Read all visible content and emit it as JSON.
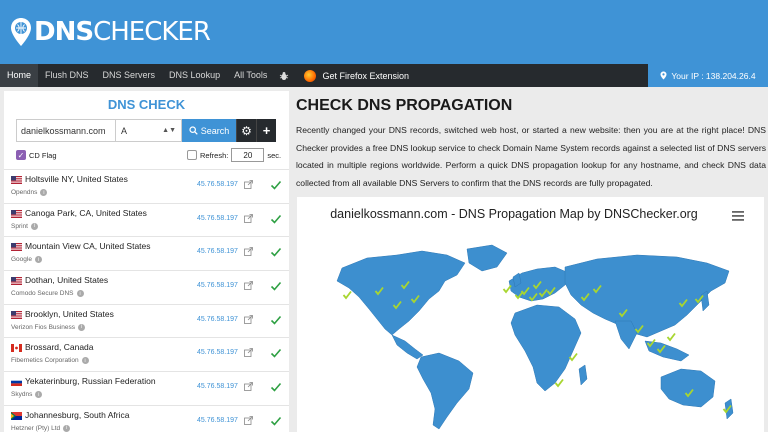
{
  "header": {
    "logo_dns": "DNS",
    "logo_checker": "CHECKER"
  },
  "nav": {
    "items": [
      "Home",
      "Flush DNS",
      "DNS Servers",
      "DNS Lookup",
      "All Tools"
    ],
    "firefox": "Get Firefox Extension",
    "ip": "Your IP : 138.204.26.4"
  },
  "dns_check": {
    "title": "DNS CHECK",
    "domain_value": "danielkossmann.com",
    "record_type": "A",
    "search_label": "Search",
    "cd_flag_label": "CD Flag",
    "refresh_label": "Refresh:",
    "refresh_value": "20",
    "refresh_unit": "sec."
  },
  "servers": [
    {
      "location": "Holtsville NY, United States",
      "provider": "Opendns",
      "ip": "45.76.58.197",
      "flag": "us"
    },
    {
      "location": "Canoga Park, CA, United States",
      "provider": "Sprint",
      "ip": "45.76.58.197",
      "flag": "us"
    },
    {
      "location": "Mountain View CA, United States",
      "provider": "Google",
      "ip": "45.76.58.197",
      "flag": "us"
    },
    {
      "location": "Dothan, United States",
      "provider": "Comodo Secure DNS",
      "ip": "45.76.58.197",
      "flag": "us"
    },
    {
      "location": "Brooklyn, United States",
      "provider": "Verizon Fios Business",
      "ip": "45.76.58.197",
      "flag": "us"
    },
    {
      "location": "Brossard, Canada",
      "provider": "Fibernetics Corporation",
      "ip": "45.76.58.197",
      "flag": "ca"
    },
    {
      "location": "Yekaterinburg, Russian Federation",
      "provider": "Skydns",
      "ip": "45.76.58.197",
      "flag": "ru"
    },
    {
      "location": "Johannesburg, South Africa",
      "provider": "Hetzner (Pty) Ltd",
      "ip": "45.76.58.197",
      "flag": "za"
    }
  ],
  "main": {
    "title": "CHECK DNS PROPAGATION",
    "description": "Recently changed your DNS records, switched web host, or started a new website: then you are at the right place! DNS Checker provides a free DNS lookup service to check Domain Name System records against a selected list of DNS servers located in multiple regions worldwide. Perform a quick DNS propagation lookup for any hostname, and check DNS data collected from all available DNS Servers to confirm that the DNS records are fully propagated.",
    "map_title": "danielkossmann.com - DNS Propagation Map by DNSChecker.org"
  },
  "colors": {
    "brand": "#3f93d6",
    "nav_bg": "#262a2e",
    "ok": "#2ea043",
    "map_land": "#3d8fcf",
    "check_marker": "#a8d630"
  },
  "icons": [
    "location-pin-icon",
    "bug-icon",
    "firefox-icon",
    "search-icon",
    "gear-icon",
    "plus-icon",
    "external-link-icon",
    "check-icon",
    "info-icon",
    "hamburger-menu-icon"
  ]
}
